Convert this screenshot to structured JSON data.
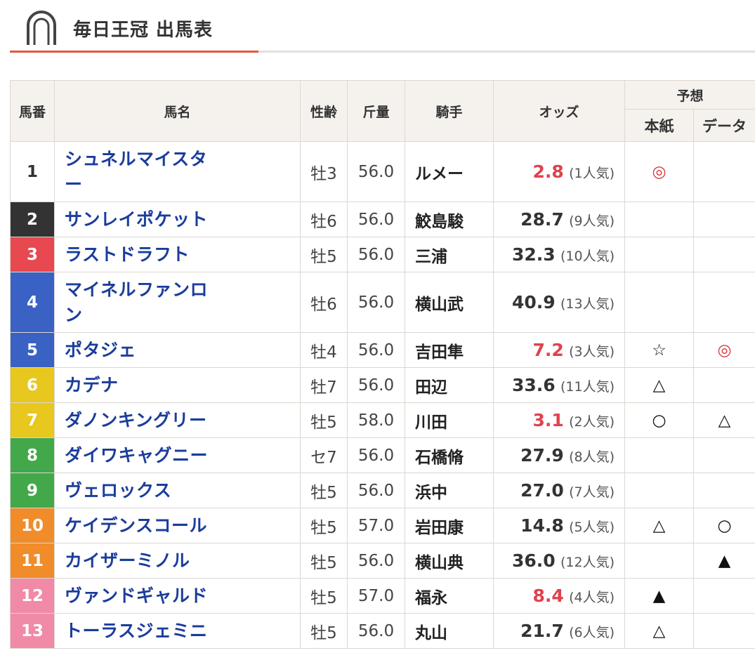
{
  "page": {
    "title": "毎日王冠 出馬表"
  },
  "table": {
    "headers": {
      "umaban": "馬番",
      "name": "馬名",
      "sexage": "性齢",
      "weight": "斤量",
      "jockey": "騎手",
      "odds": "オッズ",
      "prediction": "予想",
      "honshi": "本紙",
      "data": "データ"
    },
    "rows": [
      {
        "num": "1",
        "color": "#ffffff",
        "text_color": "#333333",
        "name": "シュネルマイスター",
        "sexage": "牡3",
        "weight": "56.0",
        "jockey": "ルメー",
        "odds": "2.8",
        "pop": "(1人気)",
        "fav": true,
        "honshi": "◎",
        "data": ""
      },
      {
        "num": "2",
        "color": "#333333",
        "text_color": "#ffffff",
        "name": "サンレイポケット",
        "sexage": "牡6",
        "weight": "56.0",
        "jockey": "鮫島駿",
        "odds": "28.7",
        "pop": "(9人気)",
        "fav": false,
        "honshi": "",
        "data": ""
      },
      {
        "num": "3",
        "color": "#e8484f",
        "text_color": "#ffffff",
        "name": "ラストドラフト",
        "sexage": "牡5",
        "weight": "56.0",
        "jockey": "三浦",
        "odds": "32.3",
        "pop": "(10人気)",
        "fav": false,
        "honshi": "",
        "data": ""
      },
      {
        "num": "4",
        "color": "#3a62c4",
        "text_color": "#ffffff",
        "name": "マイネルファンロン",
        "sexage": "牡6",
        "weight": "56.0",
        "jockey": "横山武",
        "odds": "40.9",
        "pop": "(13人気)",
        "fav": false,
        "honshi": "",
        "data": ""
      },
      {
        "num": "5",
        "color": "#3a62c4",
        "text_color": "#ffffff",
        "name": "ポタジェ",
        "sexage": "牡4",
        "weight": "56.0",
        "jockey": "吉田隼",
        "odds": "7.2",
        "pop": "(3人気)",
        "fav": true,
        "honshi": "☆",
        "data": "◎"
      },
      {
        "num": "6",
        "color": "#e8c71f",
        "text_color": "#ffffff",
        "name": "カデナ",
        "sexage": "牡7",
        "weight": "56.0",
        "jockey": "田辺",
        "odds": "33.6",
        "pop": "(11人気)",
        "fav": false,
        "honshi": "△",
        "data": ""
      },
      {
        "num": "7",
        "color": "#e8c71f",
        "text_color": "#ffffff",
        "name": "ダノンキングリー",
        "sexage": "牡5",
        "weight": "58.0",
        "jockey": "川田",
        "odds": "3.1",
        "pop": "(2人気)",
        "fav": true,
        "honshi": "○",
        "data": "△"
      },
      {
        "num": "8",
        "color": "#43a84a",
        "text_color": "#ffffff",
        "name": "ダイワキャグニー",
        "sexage": "セ7",
        "weight": "56.0",
        "jockey": "石橋脩",
        "odds": "27.9",
        "pop": "(8人気)",
        "fav": false,
        "honshi": "",
        "data": ""
      },
      {
        "num": "9",
        "color": "#43a84a",
        "text_color": "#ffffff",
        "name": "ヴェロックス",
        "sexage": "牡5",
        "weight": "56.0",
        "jockey": "浜中",
        "odds": "27.0",
        "pop": "(7人気)",
        "fav": false,
        "honshi": "",
        "data": ""
      },
      {
        "num": "10",
        "color": "#f08c2a",
        "text_color": "#ffffff",
        "name": "ケイデンスコール",
        "sexage": "牡5",
        "weight": "57.0",
        "jockey": "岩田康",
        "odds": "14.8",
        "pop": "(5人気)",
        "fav": false,
        "honshi": "△",
        "data": "○"
      },
      {
        "num": "11",
        "color": "#f08c2a",
        "text_color": "#ffffff",
        "name": "カイザーミノル",
        "sexage": "牡5",
        "weight": "56.0",
        "jockey": "横山典",
        "odds": "36.0",
        "pop": "(12人気)",
        "fav": false,
        "honshi": "",
        "data": "▲"
      },
      {
        "num": "12",
        "color": "#f18aa6",
        "text_color": "#ffffff",
        "name": "ヴァンドギャルド",
        "sexage": "牡5",
        "weight": "57.0",
        "jockey": "福永",
        "odds": "8.4",
        "pop": "(4人気)",
        "fav": true,
        "honshi": "▲",
        "data": ""
      },
      {
        "num": "13",
        "color": "#f18aa6",
        "text_color": "#ffffff",
        "name": "トーラスジェミニ",
        "sexage": "牡5",
        "weight": "56.0",
        "jockey": "丸山",
        "odds": "21.7",
        "pop": "(6人気)",
        "fav": false,
        "honshi": "△",
        "data": ""
      }
    ]
  }
}
